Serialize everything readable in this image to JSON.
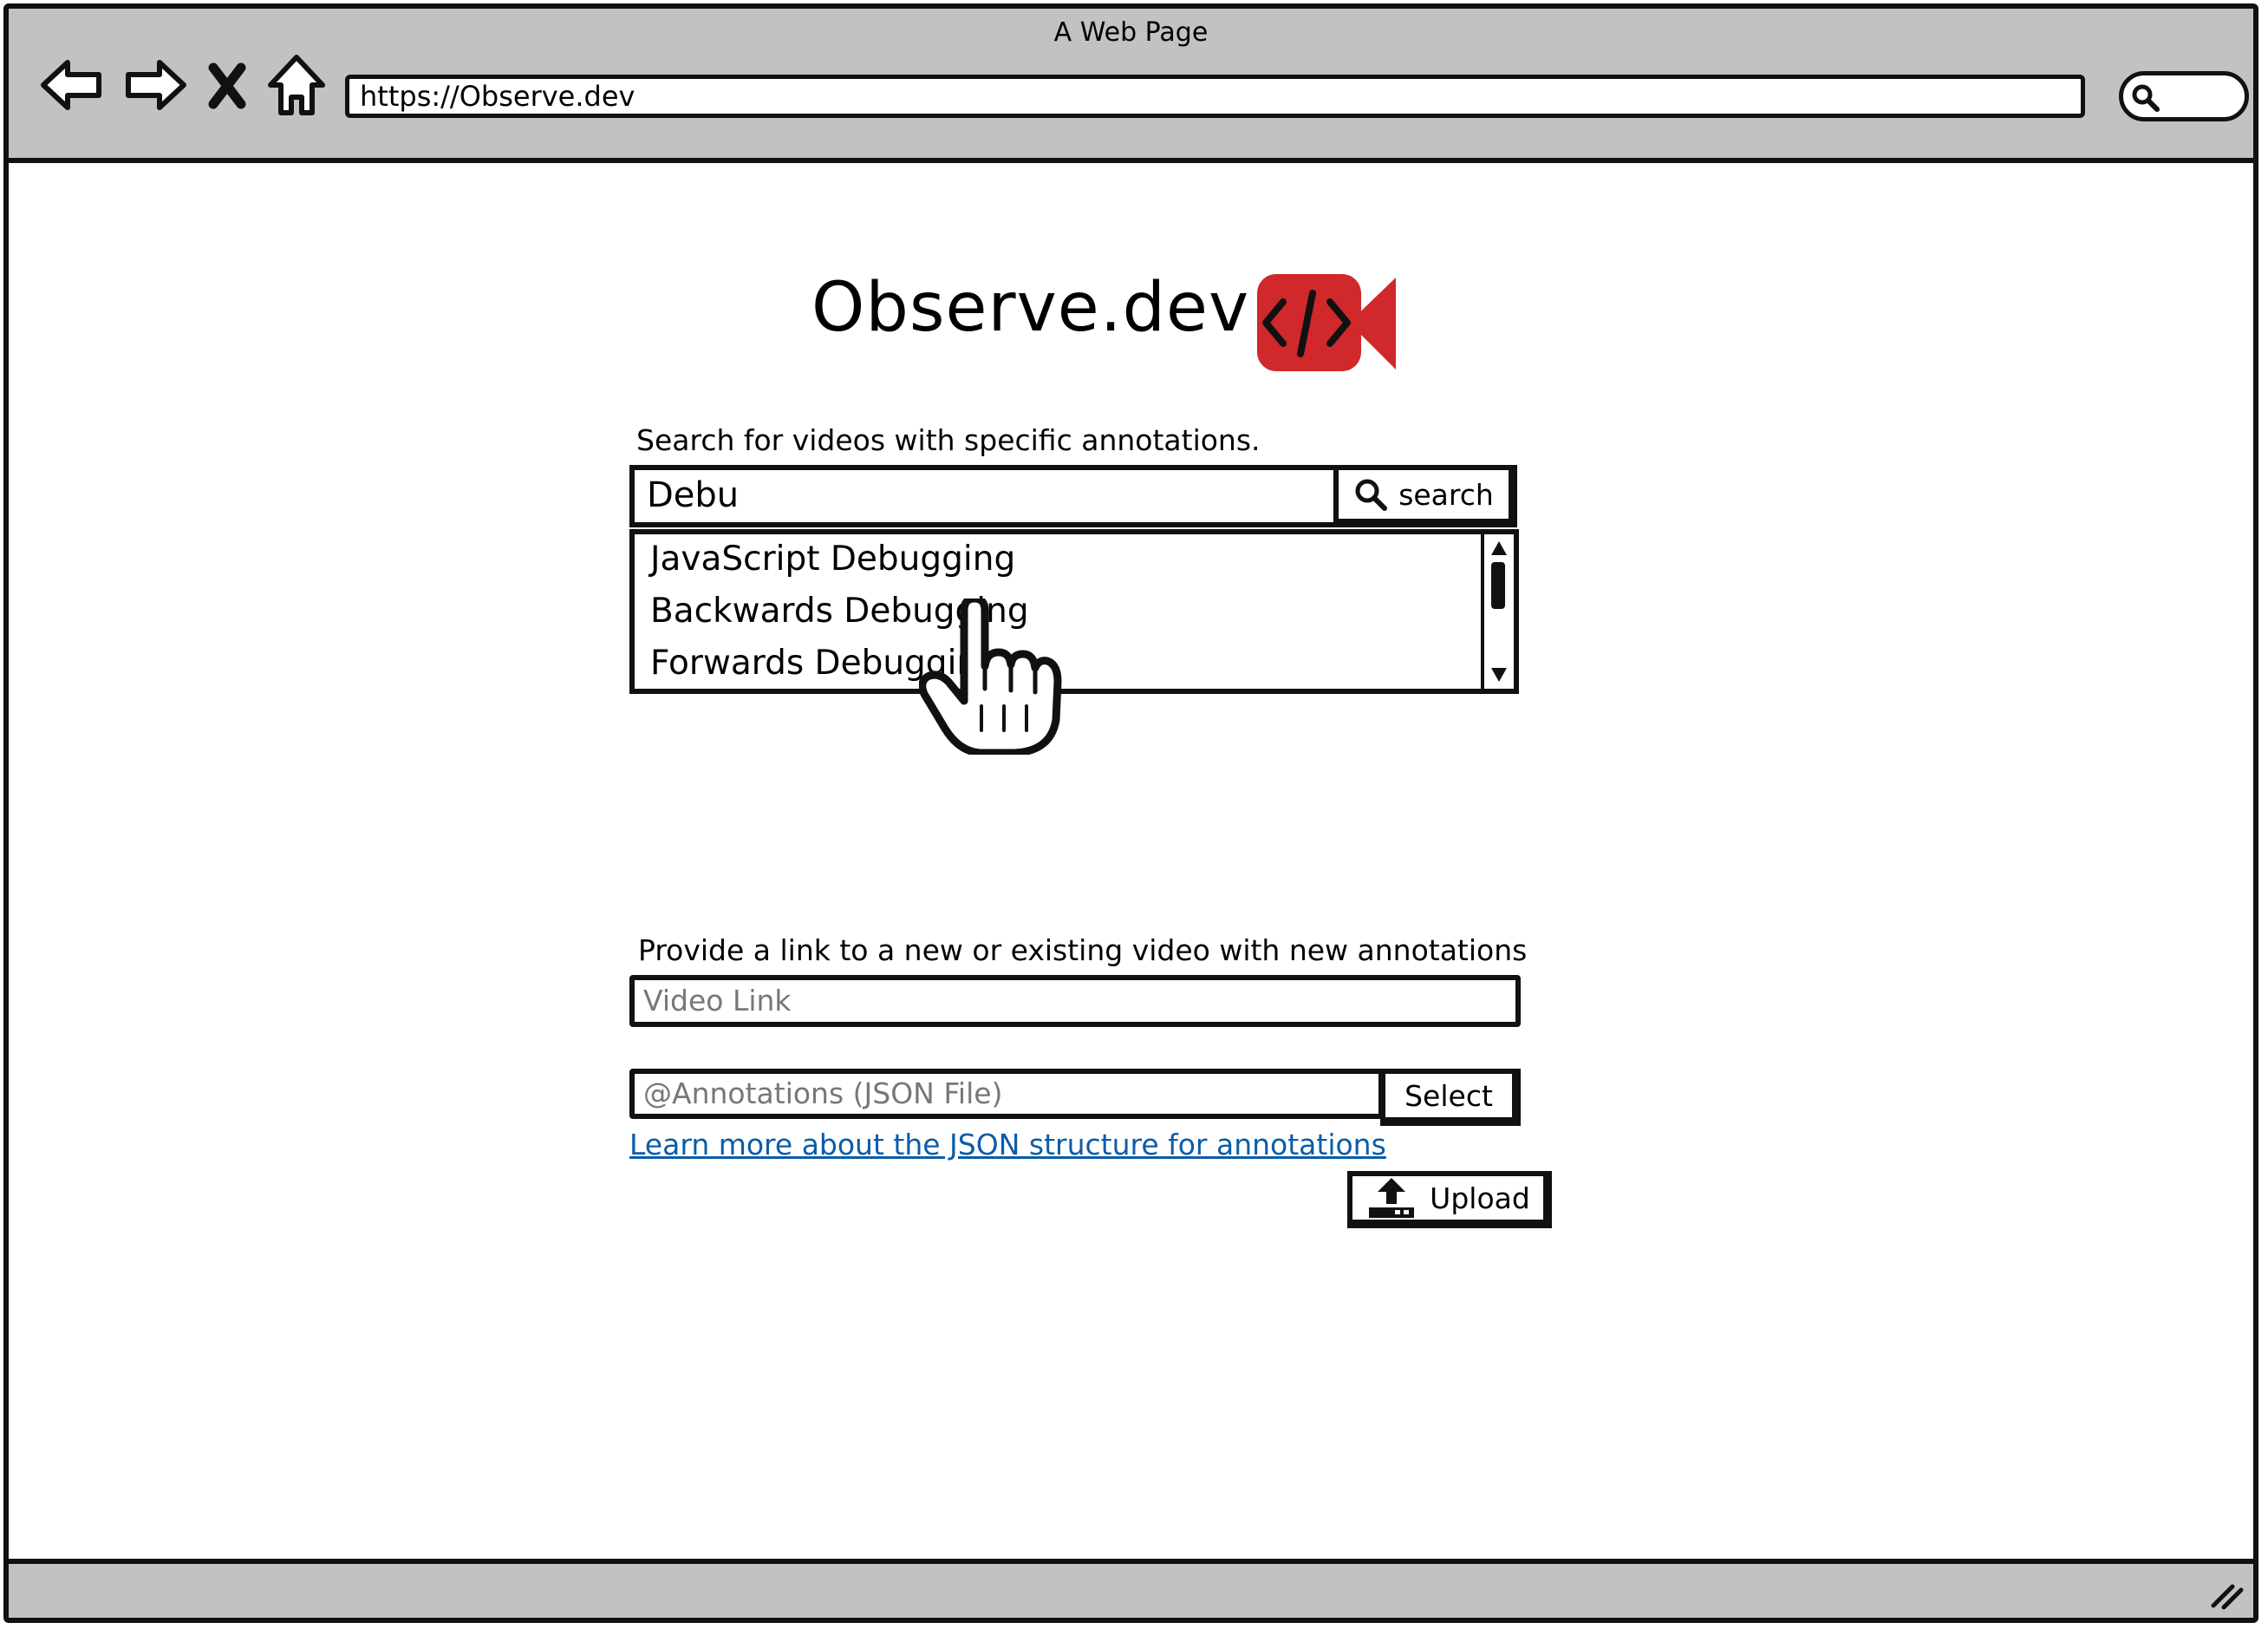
{
  "window": {
    "title": "A Web Page",
    "url": "https://Observe.dev"
  },
  "nav_icons": [
    "back-arrow-icon",
    "forward-arrow-icon",
    "close-icon",
    "home-icon",
    "search-icon"
  ],
  "logo": {
    "text": "Observe.dev",
    "icon": "video-code-icon",
    "icon_color": "#d0282b"
  },
  "search": {
    "label": "Search for videos with specific annotations.",
    "value": "Debu",
    "button_label": "search",
    "suggestions": [
      "JavaScript Debugging",
      "Backwards Debugging",
      "Forwards Debugging"
    ]
  },
  "upload_form": {
    "label": "Provide a link to a new or existing video with new annotations",
    "video_link_placeholder": "Video Link",
    "annotations_placeholder": "@Annotations (JSON File)",
    "select_label": "Select",
    "learn_more_link": "Learn more about the JSON structure for annotations",
    "upload_label": "Upload"
  },
  "colors": {
    "chrome": "#c2c2c2",
    "link": "#0b5ca8",
    "brand": "#d0282b"
  }
}
